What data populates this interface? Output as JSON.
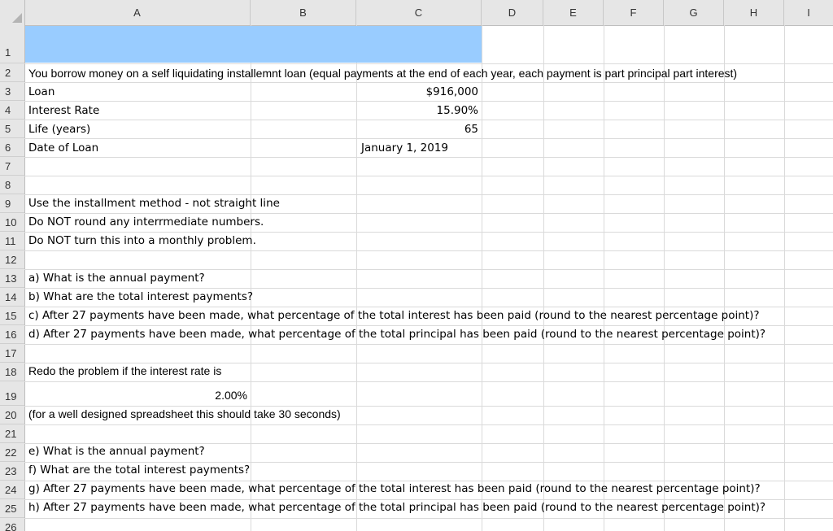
{
  "columns": [
    "A",
    "B",
    "C",
    "D",
    "E",
    "F",
    "G",
    "H",
    "I"
  ],
  "rows": [
    "1",
    "2",
    "3",
    "4",
    "5",
    "6",
    "7",
    "8",
    "9",
    "10",
    "11",
    "12",
    "13",
    "14",
    "15",
    "16",
    "17",
    "18",
    "19",
    "20",
    "21",
    "22",
    "23",
    "24",
    "25",
    "26"
  ],
  "cells": {
    "r2": "You borrow money on a self liquidating installemnt loan (equal payments at the end of each year, each payment is part principal part interest)",
    "r3_label": "Loan",
    "r3_value": "$916,000",
    "r4_label": "Interest Rate",
    "r4_value": "15.90%",
    "r5_label": "Life (years)",
    "r5_value": "65",
    "r6_label": "Date of Loan",
    "r6_value": "January 1, 2019",
    "r9": "Use the installment method - not straight line",
    "r10": "Do NOT round any interrmediate numbers.",
    "r11": "Do NOT turn this into a monthly problem.",
    "r13": "a) What is the annual payment?",
    "r14": "b) What are the total interest payments?",
    "r15": "c) After 27 payments have been made, what percentage of the total interest has been paid (round to the nearest percentage point)?",
    "r16": "d) After 27 payments have been made, what percentage of the total principal has been paid (round to the nearest percentage point)?",
    "r18": "Redo the problem if the interest rate is",
    "r19_value": "2.00%",
    "r20": "(for a well designed spreadsheet this should take 30 seconds)",
    "r22": "e) What is the annual payment?",
    "r23": "f) What are the total interest payments?",
    "r24": "g) After 27 payments have been made, what percentage of the total interest has been paid (round to the nearest percentage point)?",
    "r25": "h) After 27 payments have been made, what percentage of the total principal has been paid (round to the nearest percentage point)?"
  },
  "colors": {
    "header_bg": "#e6e6e6",
    "highlight_fill": "#99ccff",
    "grid": "#dadada"
  }
}
